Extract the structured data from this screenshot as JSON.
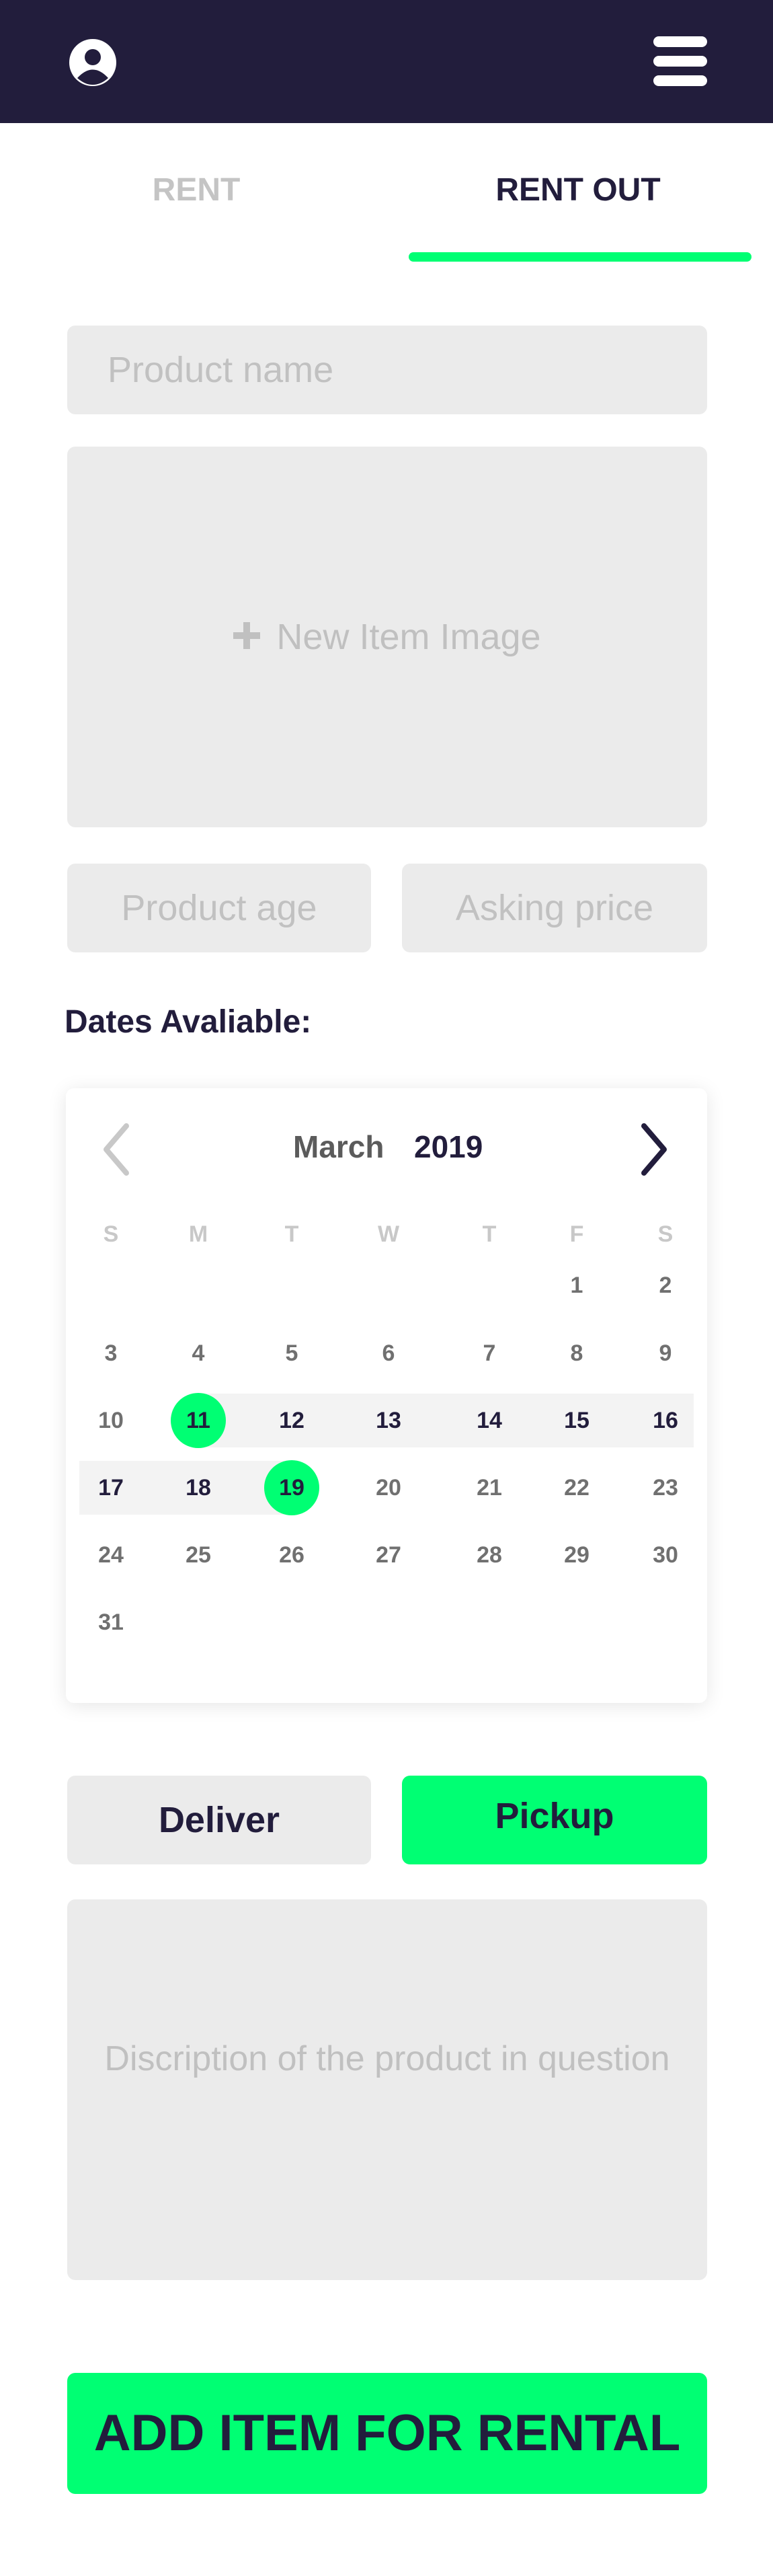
{
  "header": {
    "profile_icon": "user-circle-icon",
    "menu_icon": "hamburger-menu-icon",
    "background": "#221d3c"
  },
  "tabs": {
    "rent": "RENT",
    "rent_out": "RENT OUT",
    "active": "RENT OUT",
    "active_color": "#00ff73"
  },
  "form": {
    "product_name_placeholder": "Product name",
    "image_icon": "plus-icon",
    "image_label": "New Item Image",
    "product_age_placeholder": "Product age",
    "asking_price_placeholder": "Asking price",
    "dates_label": "Dates Avaliable:",
    "description_placeholder": "Discription of the product in question"
  },
  "calendar": {
    "month": "March",
    "year": "2019",
    "weekdays": [
      "S",
      "M",
      "T",
      "W",
      "T",
      "F",
      "S"
    ],
    "weeks": [
      [
        "",
        "",
        "",
        "",
        "",
        "1",
        "2"
      ],
      [
        "3",
        "4",
        "5",
        "6",
        "7",
        "8",
        "9"
      ],
      [
        "10",
        "11",
        "12",
        "13",
        "14",
        "15",
        "16"
      ],
      [
        "17",
        "18",
        "19",
        "20",
        "21",
        "22",
        "23"
      ],
      [
        "24",
        "25",
        "26",
        "27",
        "28",
        "29",
        "30"
      ],
      [
        "31",
        "",
        "",
        "",
        "",
        "",
        ""
      ]
    ],
    "range_start": "11",
    "range_end": "19",
    "prev_icon": "chevron-left-icon",
    "next_icon": "chevron-right-icon"
  },
  "delivery": {
    "deliver": "Deliver",
    "pickup": "Pickup",
    "selected": "Pickup"
  },
  "submit": {
    "label": "ADD ITEM FOR RENTAL"
  },
  "colors": {
    "accent": "#00ff73",
    "dark": "#221d3c",
    "field": "#ebebeb"
  }
}
